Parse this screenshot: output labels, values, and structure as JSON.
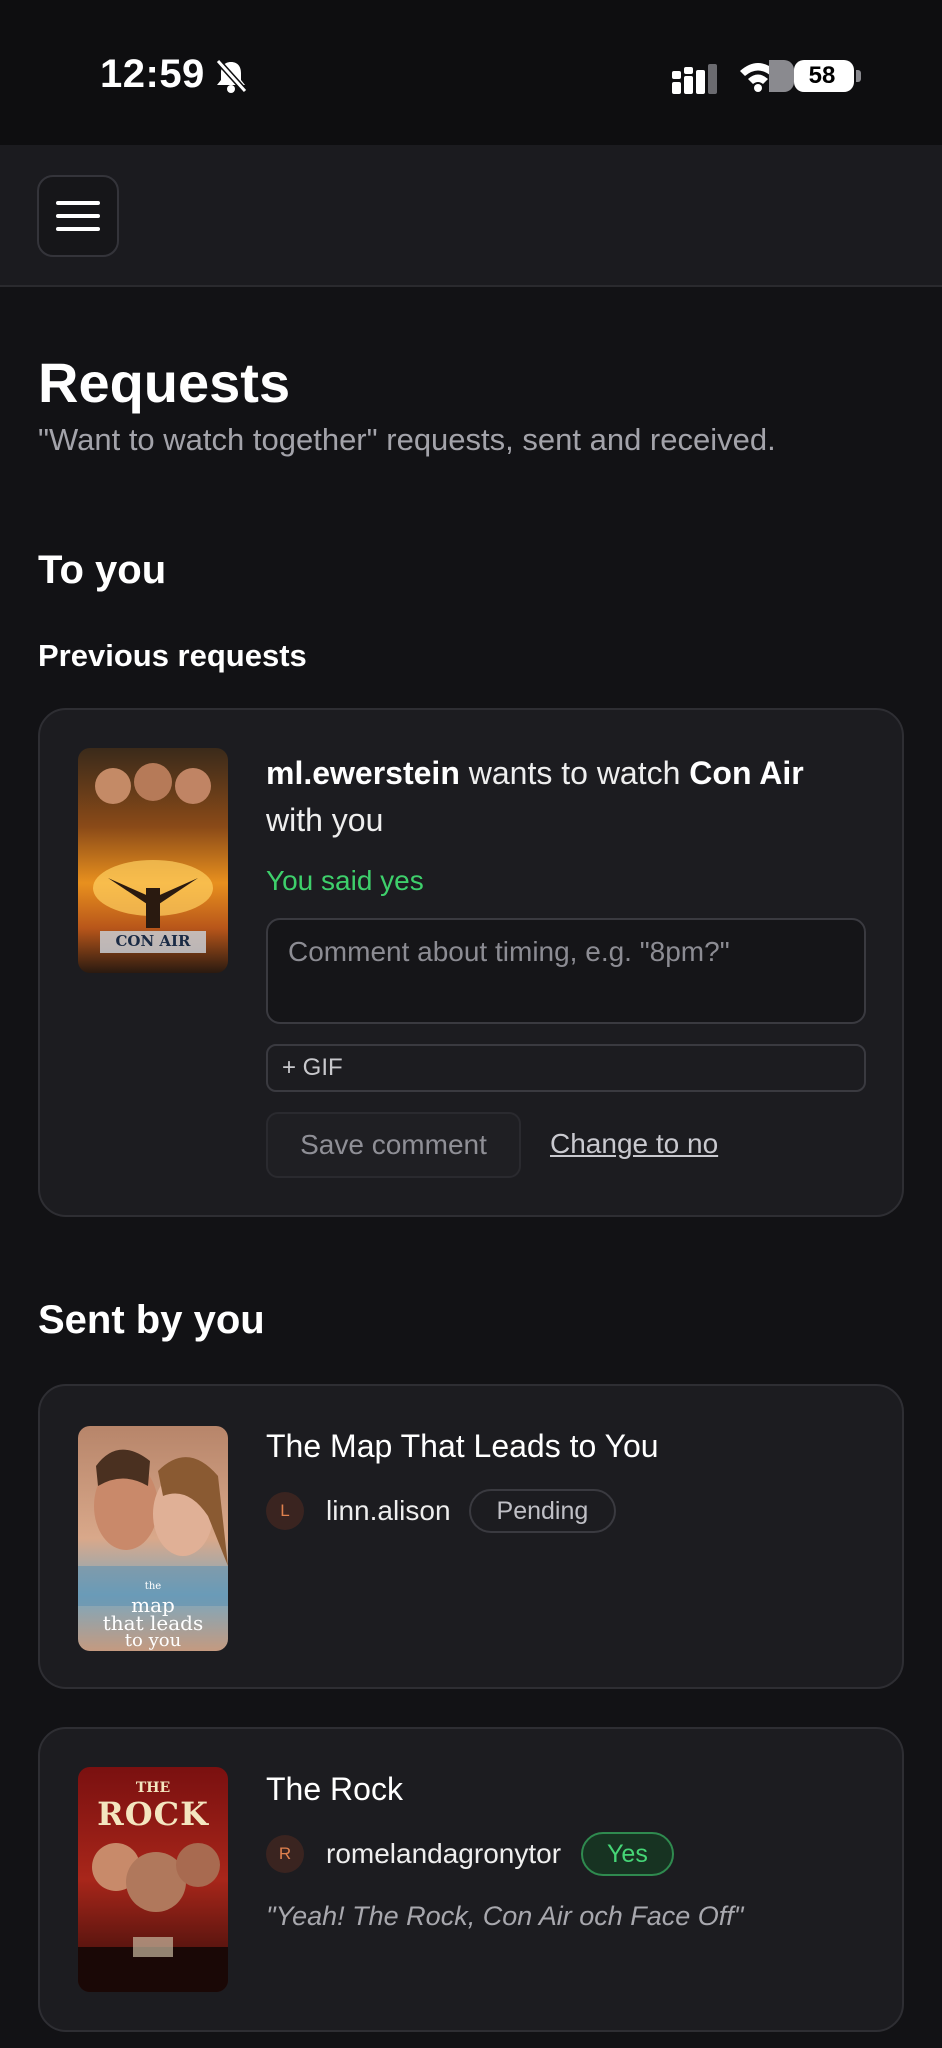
{
  "status_bar": {
    "time": "12:59",
    "battery": "58",
    "icons": [
      "bell-slash-icon",
      "cellular-signal-icon",
      "wifi-icon",
      "battery-icon"
    ]
  },
  "header": {
    "menu_icon": "hamburger-menu-icon"
  },
  "page": {
    "title": "Requests",
    "subtitle": "\"Want to watch together\" requests, sent and received."
  },
  "to_you": {
    "heading": "To you",
    "previous_heading": "Previous requests",
    "requests": [
      {
        "user": "ml.ewerstein",
        "phrase": "wants to watch",
        "movie": "Con Air",
        "suffix": "with you",
        "status": "You said yes",
        "poster_text": "CON AIR",
        "comment_placeholder": "Comment about timing, e.g. \"8pm?\"",
        "gif_label": "+ GIF",
        "save_label": "Save comment",
        "change_label": "Change to no"
      }
    ]
  },
  "sent_by_you": {
    "heading": "Sent by you",
    "requests": [
      {
        "movie": "The Map That Leads to You",
        "avatar_initial": "L",
        "user": "linn.alison",
        "status": "Pending",
        "poster_lines": [
          "the",
          "map",
          "that leads",
          "to you"
        ]
      },
      {
        "movie": "The Rock",
        "avatar_initial": "R",
        "user": "romelandagronytor",
        "status": "Yes",
        "comment": "\"Yeah! The Rock, Con Air och Face Off\"",
        "poster_lines": [
          "THE",
          "ROCK"
        ]
      }
    ]
  },
  "colors": {
    "background": "#121215",
    "card": "#1c1c20",
    "success_green": "#3ecf6b",
    "avatar_accent": "#e0814e"
  }
}
